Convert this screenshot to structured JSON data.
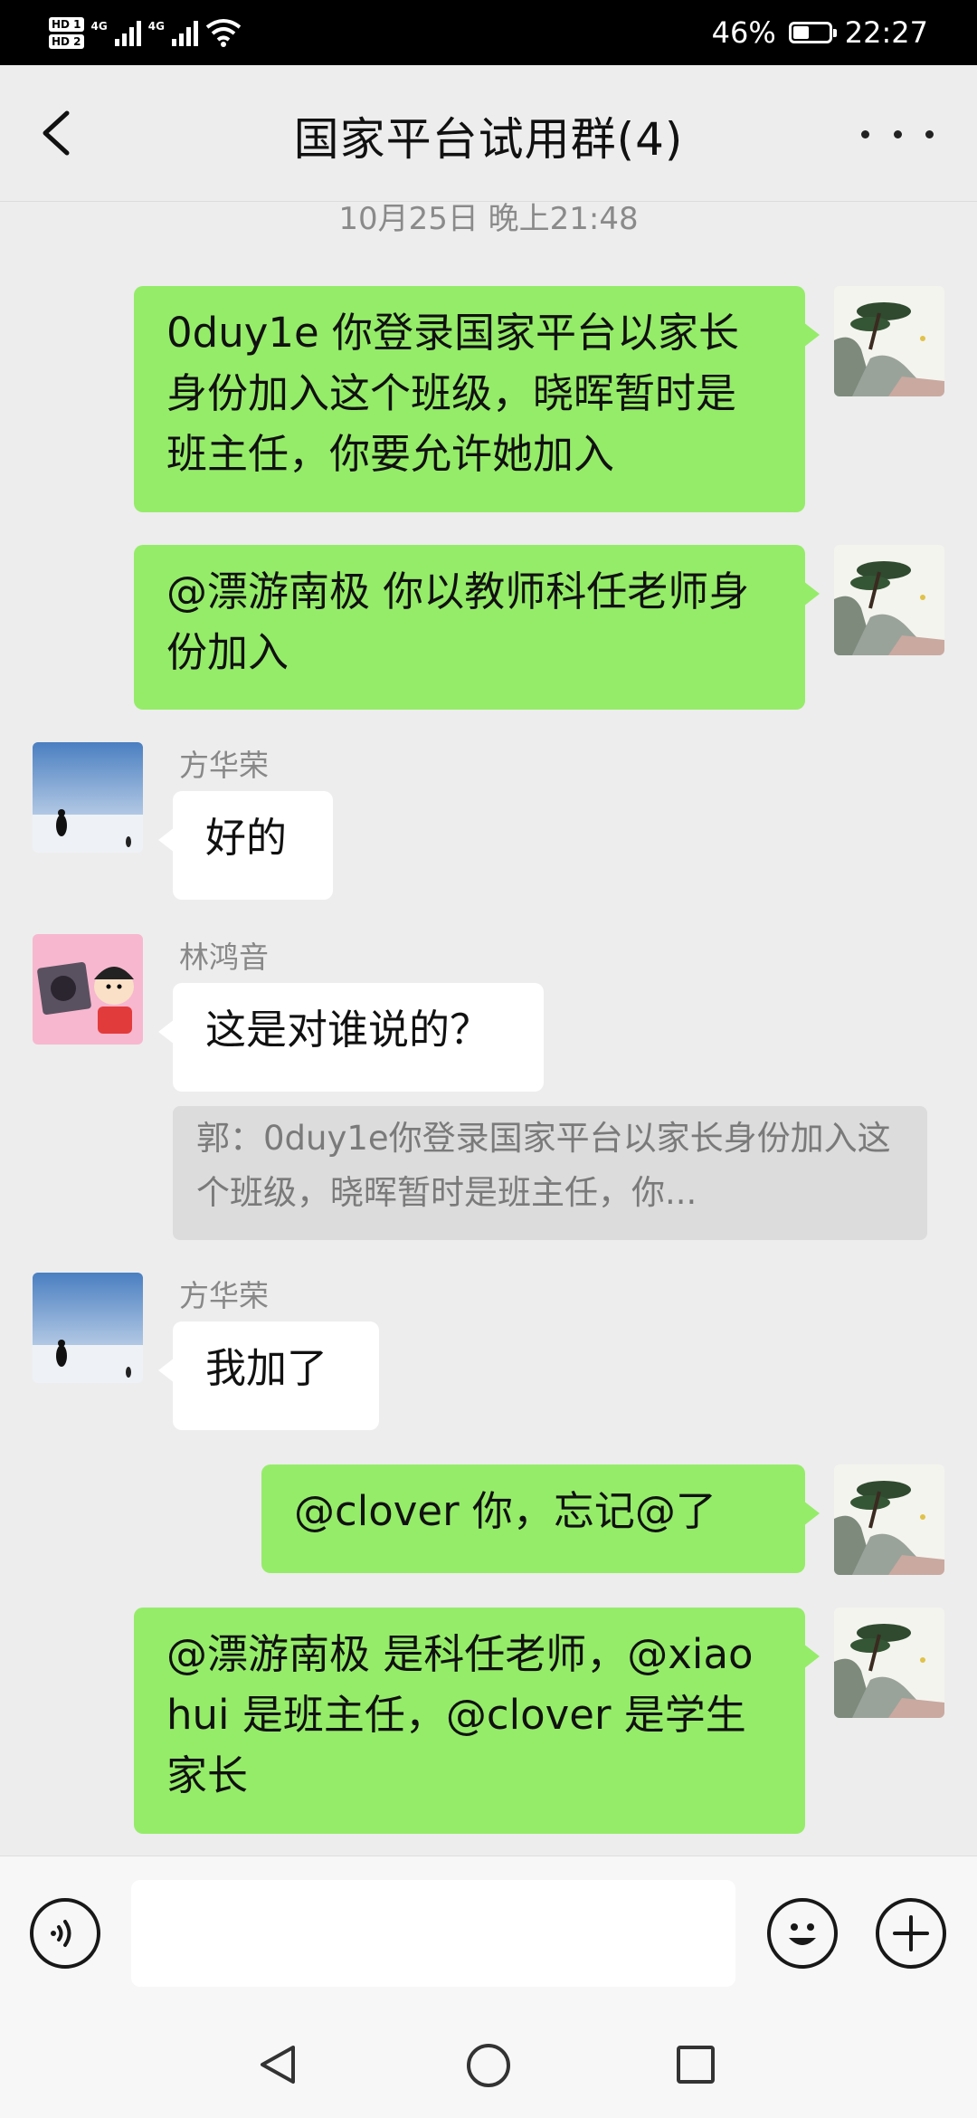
{
  "status_bar": {
    "hd1": "HD 1",
    "hd2": "HD 2",
    "net1": "4G",
    "net2": "4G",
    "battery": "46%",
    "battery_level": 0.46,
    "time": "22:27"
  },
  "header": {
    "title": "国家平台试用群(4)"
  },
  "chat": {
    "timestamp": "10月25日 晚上21:48",
    "messages": [
      {
        "from": "me",
        "text": "0duy1e 你登录国家平台以家长身份加入这个班级，晓晖暂时是班主任，你要允许她加入"
      },
      {
        "from": "me",
        "text": "@漂游南极  你以教师科任老师身份加入"
      },
      {
        "from": "other",
        "sender": "方华荣",
        "text": "好的"
      },
      {
        "from": "other",
        "sender": "林鸿音",
        "text": "这是对谁说的？",
        "quote": "郭：0duy1e你登录国家平台以家长身份加入这个班级，晓晖暂时是班主任，你..."
      },
      {
        "from": "other",
        "sender": "方华荣",
        "text": "我加了"
      },
      {
        "from": "me",
        "text": "@clover 你，忘记@了"
      },
      {
        "from": "me",
        "text": "@漂游南极  是科任老师，@xiaohui 是班主任，@clover 是学生家长"
      }
    ]
  },
  "input": {
    "voice_icon": "voice-icon",
    "emoji_icon": "emoji-icon",
    "plus_icon": "plus-icon"
  },
  "colors": {
    "my_bubble": "#95ec69",
    "other_bubble": "#ffffff",
    "background": "#ededed"
  }
}
